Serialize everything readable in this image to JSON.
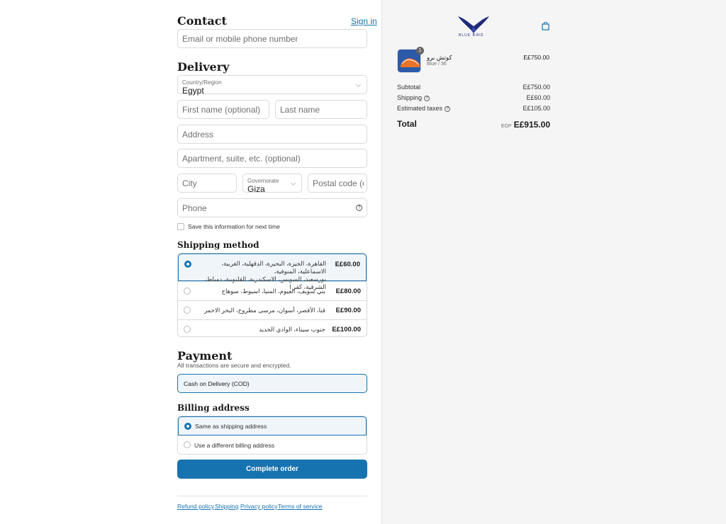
{
  "contact": {
    "heading": "Contact",
    "sign_in": "Sign in",
    "email_placeholder": "Email or mobile phone number"
  },
  "delivery": {
    "heading": "Delivery",
    "country_label": "Country/Region",
    "country_value": "Egypt",
    "first_name_placeholder": "First name (optional)",
    "last_name_placeholder": "Last name",
    "address_placeholder": "Address",
    "apartment_placeholder": "Apartment, suite, etc. (optional)",
    "city_placeholder": "City",
    "governorate_label": "Governorate",
    "governorate_value": "Giza",
    "postal_placeholder": "Postal code (optional)",
    "phone_placeholder": "Phone",
    "save_info_label": "Save this information for next time"
  },
  "shipping_method": {
    "heading": "Shipping method",
    "options": [
      {
        "label_line1": "القاهرة، الجيزة، البحيرة، الدقهلية، الغربية، الاسماعلية، المنوفية،",
        "label_line2": "بورسعيد، السويس، الاسكندرية، القليوبية، دمياط، الشرقية، كفر ا",
        "price": "E£60.00",
        "selected": true
      },
      {
        "label_line1": "بني سويف، الفيوم، المنيا، اسيوط، سوهاج",
        "label_line2": "",
        "price": "E£80.00",
        "selected": false
      },
      {
        "label_line1": "قنا، الأقصر، أسوان، مرسى مطروح، البحر الاحمر",
        "label_line2": "",
        "price": "E£90.00",
        "selected": false
      },
      {
        "label_line1": "جنوب سيناء، الوادي الجديد",
        "label_line2": "",
        "price": "E£100.00",
        "selected": false
      }
    ]
  },
  "payment": {
    "heading": "Payment",
    "subtitle": "All transactions are secure and encrypted.",
    "method": "Cash on Delivery (COD)"
  },
  "billing": {
    "heading": "Billing address",
    "same_label": "Same as shipping address",
    "different_label": "Use a different billing address"
  },
  "complete_button": "Complete order",
  "footer": {
    "refund": "Refund policy",
    "shipping": "Shipping",
    "privacy": "Privacy policy",
    "terms": "Terms of service"
  },
  "summary": {
    "logo_text": "BLUE BIRD",
    "product": {
      "name": "كوتش برو",
      "variant": "Blue / 36",
      "price": "E£750.00",
      "quantity": "1"
    },
    "subtotal_label": "Subtotal",
    "subtotal_value": "E£750.00",
    "shipping_label": "Shipping",
    "shipping_value": "E£60.00",
    "taxes_label": "Estimated taxes",
    "taxes_value": "E£105.00",
    "total_label": "Total",
    "currency": "EGP",
    "total_value": "E£915.00"
  },
  "colors": {
    "accent": "#1773b0",
    "summary_bg": "#f5f5f5"
  }
}
